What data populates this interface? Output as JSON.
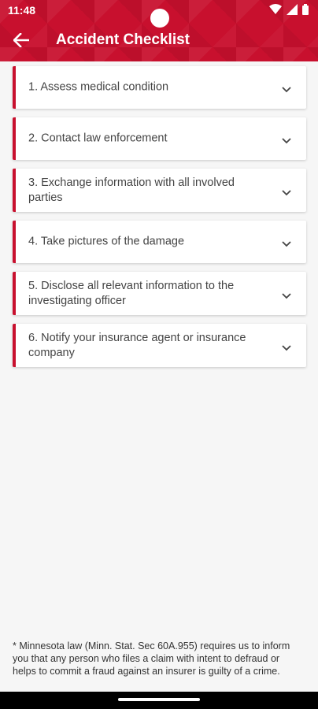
{
  "status_bar": {
    "time": "11:48",
    "icons": [
      "wifi-icon",
      "signal-icon",
      "battery-icon"
    ]
  },
  "app_bar": {
    "back_icon": "arrow-left-icon",
    "title": "Accident Checklist"
  },
  "checklist": [
    {
      "label": "1. Assess medical condition"
    },
    {
      "label": "2. Contact law enforcement"
    },
    {
      "label": "3. Exchange information with all involved parties"
    },
    {
      "label": "4. Take pictures of the damage"
    },
    {
      "label": "5. Disclose all relevant information to the investigating officer"
    },
    {
      "label": "6. Notify your insurance agent or insurance company"
    }
  ],
  "footnote": "* Minnesota law (Minn. Stat. Sec 60A.955) requires us to inform you that any person who files a claim with intent to defraud or helps to commit a fraud against an insurer is guilty of a crime.",
  "colors": {
    "accent": "#c8102e",
    "background": "#f6f6f6"
  }
}
